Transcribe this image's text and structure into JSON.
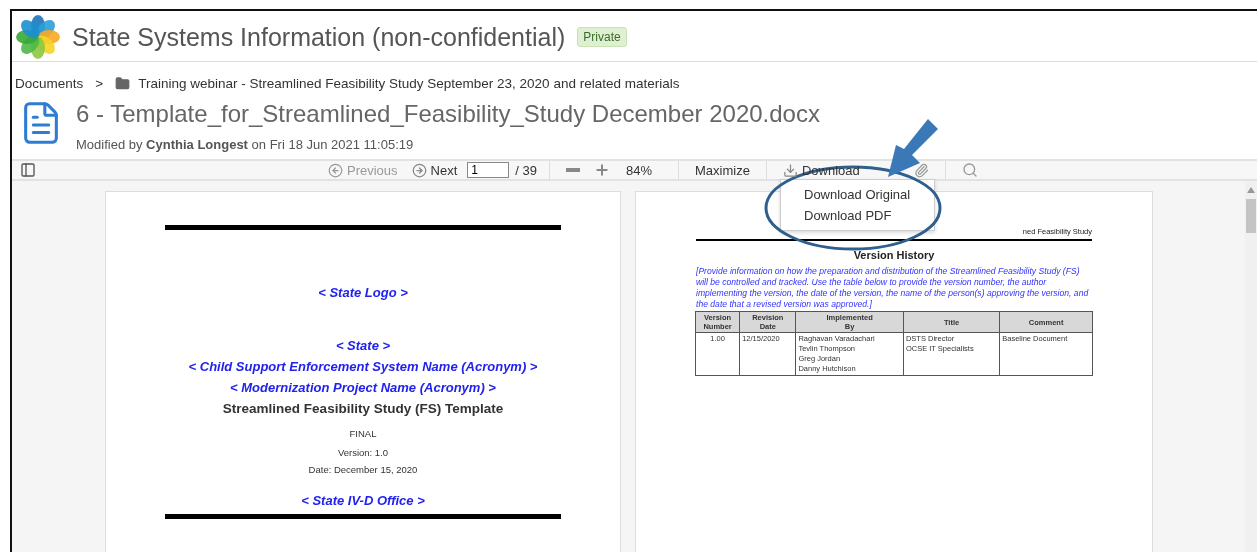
{
  "header": {
    "title": "State Systems Information (non-confidential)",
    "badge": "Private"
  },
  "breadcrumb": {
    "root": "Documents",
    "separator": ">",
    "folder": "Training webinar - Streamlined Feasibility Study September 23, 2020 and related materials"
  },
  "document": {
    "title": "6 - Template_for_Streamlined_Feasibility_Study December 2020.docx",
    "modified_prefix": "Modified by",
    "author": "Cynthia Longest",
    "modified_suffix": "on Fri 18 Jun 2021 11:05:19"
  },
  "toolbar": {
    "previous": {
      "label": "Previous",
      "disabled": true
    },
    "next": {
      "label": "Next",
      "disabled": false
    },
    "page": "1",
    "page_total": "/ 39",
    "zoom": "84%",
    "maximize": "Maximize",
    "download": "Download"
  },
  "download_menu": {
    "open": true,
    "items": [
      "Download Original",
      "Download PDF"
    ]
  },
  "page_1": {
    "lines": [
      {
        "kind": "placeholder",
        "text": "< State Logo >"
      },
      {
        "kind": "placeholder",
        "text": "< State >"
      },
      {
        "kind": "placeholder",
        "text": "< Child Support Enforcement System Name (Acronym) >"
      },
      {
        "kind": "placeholder",
        "text": "< Modernization Project Name (Acronym) >"
      },
      {
        "kind": "title",
        "text": "Streamlined Feasibility Study (FS) Template"
      },
      {
        "kind": "meta",
        "text": "FINAL"
      },
      {
        "kind": "meta",
        "text": "Version:  1.0"
      },
      {
        "kind": "meta",
        "text": "Date:  December 15, 2020"
      },
      {
        "kind": "placeholder",
        "text": "< State IV-D Office >"
      }
    ]
  },
  "page_2": {
    "running_header": "ned Feasibility Study",
    "heading": "Version History",
    "instructions": "[Provide information on how the preparation and distribution of the Streamlined Feasibility Study (FS) will be controlled and tracked.  Use the table below to provide the version number, the author implementing the version, the date of the version, the name of the person(s) approving the version, and the date that a revised version was approved.]",
    "table": {
      "columns": [
        "Version\nNumber",
        "Revision\nDate",
        "Implemented\nBy",
        "Title",
        "Comment"
      ],
      "rows": [
        [
          "1.00",
          "12/15/2020",
          "Raghavan Varadachari\nTevlin Thompson\nGreg Jordan\nDanny Hutchison",
          "DSTS Director\nOCSE IT Specialists",
          "Baseline Document"
        ]
      ]
    }
  }
}
